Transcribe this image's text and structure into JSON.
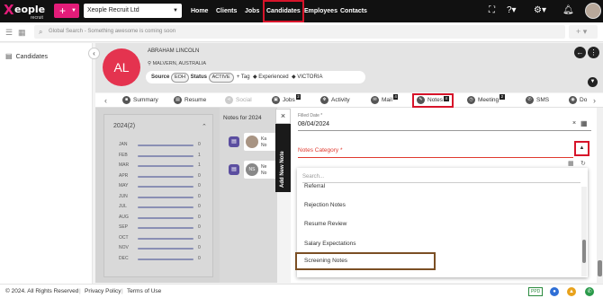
{
  "brand": {
    "logo_x": "X",
    "logo_rest": "eople",
    "logo_sub": "recruit"
  },
  "topbar": {
    "add_symbol": "+",
    "company": "Xeople Recruit Ltd",
    "nav": [
      "Home",
      "Clients",
      "Jobs",
      "Candidates",
      "Employees",
      "Contacts"
    ],
    "active_nav": "Candidates"
  },
  "search": {
    "placeholder": "Global Search - Something awesome is coming soon",
    "plus": "+"
  },
  "sidebar": {
    "items": [
      {
        "label": "Candidates"
      }
    ]
  },
  "candidate": {
    "initials": "AL",
    "name": "ABRAHAM LINCOLN",
    "location": "MALVERN, AUSTRALIA",
    "source_label": "Source",
    "source_value": "EOH",
    "status_label": "Status",
    "status_value": "ACTIVE",
    "tag_label": "+ Tag",
    "tags": [
      "Experienced",
      "VICTORIA"
    ]
  },
  "tabs": [
    {
      "label": "Summary",
      "icon": "summary-icon"
    },
    {
      "label": "Resume",
      "icon": "resume-icon"
    },
    {
      "label": "Social",
      "icon": "social-icon"
    },
    {
      "label": "Jobs",
      "count": "2",
      "icon": "jobs-icon"
    },
    {
      "label": "Activity",
      "icon": "activity-icon"
    },
    {
      "label": "Mail",
      "count": "4",
      "icon": "mail-icon"
    },
    {
      "label": "Notes",
      "count": "4",
      "icon": "notes-icon"
    },
    {
      "label": "Meeting",
      "count": "2",
      "icon": "meeting-icon"
    },
    {
      "label": "SMS",
      "icon": "sms-icon"
    },
    {
      "label": "Do",
      "icon": "documents-icon"
    }
  ],
  "timeline": {
    "year_label": "2024(2)",
    "months": [
      {
        "m": "JAN",
        "c": "0"
      },
      {
        "m": "FEB",
        "c": "1"
      },
      {
        "m": "MAR",
        "c": "1"
      },
      {
        "m": "APR",
        "c": "0"
      },
      {
        "m": "MAY",
        "c": "0"
      },
      {
        "m": "JUN",
        "c": "0"
      },
      {
        "m": "JUL",
        "c": "0"
      },
      {
        "m": "AUG",
        "c": "0"
      },
      {
        "m": "SEP",
        "c": "0"
      },
      {
        "m": "OCT",
        "c": "0"
      },
      {
        "m": "NOV",
        "c": "0"
      },
      {
        "m": "DEC",
        "c": "0"
      }
    ]
  },
  "notes_list": {
    "title": "Notes for 2024",
    "items": [
      {
        "initials": "",
        "line1": "Ka",
        "line2": "No"
      },
      {
        "initials": "NS",
        "line1": "Ne",
        "line2": "No"
      }
    ]
  },
  "add_note": {
    "label": "Add New Note",
    "close": "×"
  },
  "form": {
    "filled_date_label": "Filled Date *",
    "filled_date_value": "08/04/2024",
    "notes_category_label": "Notes Category *"
  },
  "dropdown": {
    "search_placeholder": "Search...",
    "options": [
      "Referral",
      "Rejection Notes",
      "Resume Review",
      "Salary Expectations"
    ],
    "selected": "Screening Notes"
  },
  "footer": {
    "copyright": "© 2024. All Rights Reserved",
    "privacy": "Privacy Policy",
    "terms": "Terms of Use",
    "ppd": "PPD"
  }
}
